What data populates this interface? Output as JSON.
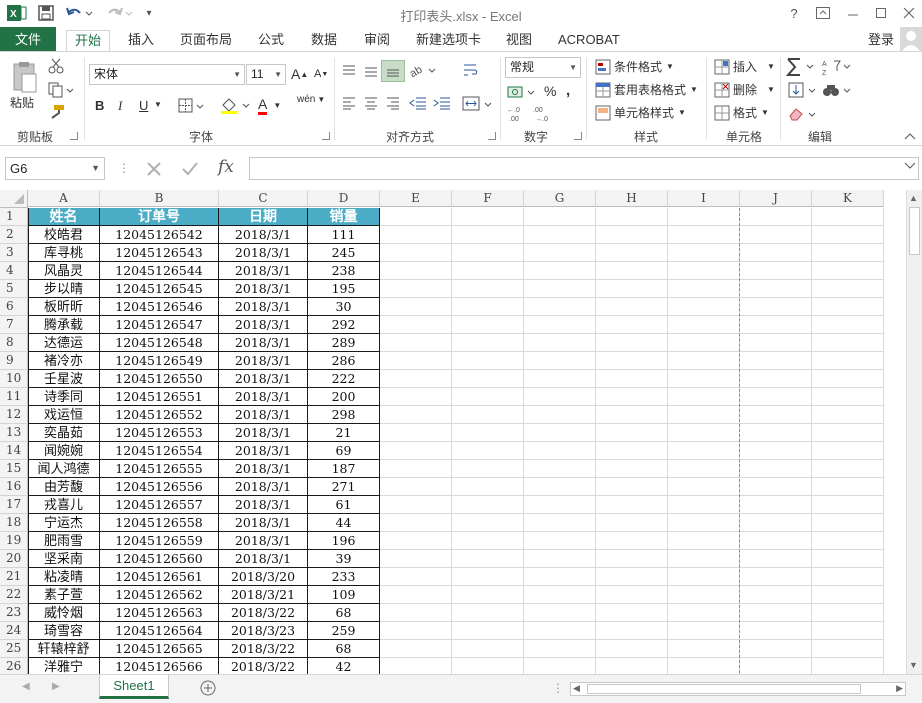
{
  "window": {
    "title": "打印表头.xlsx - Excel",
    "help": "?",
    "login": "登录"
  },
  "ribbon": {
    "file_tab": "文件",
    "tabs": [
      "开始",
      "插入",
      "页面布局",
      "公式",
      "数据",
      "审阅",
      "新建选项卡",
      "视图",
      "ACROBAT"
    ],
    "clipboard": {
      "paste": "粘贴",
      "label": "剪贴板"
    },
    "font": {
      "name": "宋体",
      "size": "11",
      "label": "字体",
      "bold": "B",
      "italic": "I",
      "underline": "U",
      "wen": "wén",
      "grow": "A",
      "shrink": "A",
      "color": "A"
    },
    "alignment": {
      "label": "对齐方式"
    },
    "number": {
      "format": "常规",
      "percent": "%",
      "comma": ",",
      "label": "数字"
    },
    "styles": {
      "conditional": "条件格式",
      "table": "套用表格格式",
      "cell": "单元格样式",
      "label": "样式"
    },
    "cells": {
      "insert": "插入",
      "delete": "删除",
      "format": "格式",
      "label": "单元格"
    },
    "editing": {
      "label": "编辑"
    }
  },
  "formula_bar": {
    "namebox": "G6",
    "fx": "fx",
    "value": ""
  },
  "columns": [
    "A",
    "B",
    "C",
    "D",
    "E",
    "F",
    "G",
    "H",
    "I",
    "J",
    "K"
  ],
  "table": {
    "headers": [
      "姓名",
      "订单号",
      "日期",
      "销量"
    ],
    "rows": [
      [
        "校皓君",
        "12045126542",
        "2018/3/1",
        "111"
      ],
      [
        "库寻桃",
        "12045126543",
        "2018/3/1",
        "245"
      ],
      [
        "风晶灵",
        "12045126544",
        "2018/3/1",
        "238"
      ],
      [
        "步以晴",
        "12045126545",
        "2018/3/1",
        "195"
      ],
      [
        "板昕昕",
        "12045126546",
        "2018/3/1",
        "30"
      ],
      [
        "腾承载",
        "12045126547",
        "2018/3/1",
        "292"
      ],
      [
        "达德运",
        "12045126548",
        "2018/3/1",
        "289"
      ],
      [
        "褚冷亦",
        "12045126549",
        "2018/3/1",
        "286"
      ],
      [
        "壬星波",
        "12045126550",
        "2018/3/1",
        "222"
      ],
      [
        "诗季同",
        "12045126551",
        "2018/3/1",
        "200"
      ],
      [
        "戏运恒",
        "12045126552",
        "2018/3/1",
        "298"
      ],
      [
        "奕晶茹",
        "12045126553",
        "2018/3/1",
        "21"
      ],
      [
        "闻婉婉",
        "12045126554",
        "2018/3/1",
        "69"
      ],
      [
        "闻人鸿德",
        "12045126555",
        "2018/3/1",
        "187"
      ],
      [
        "由芳馥",
        "12045126556",
        "2018/3/1",
        "271"
      ],
      [
        "戎喜儿",
        "12045126557",
        "2018/3/1",
        "61"
      ],
      [
        "宁运杰",
        "12045126558",
        "2018/3/1",
        "44"
      ],
      [
        "肥雨雪",
        "12045126559",
        "2018/3/1",
        "196"
      ],
      [
        "坚采南",
        "12045126560",
        "2018/3/1",
        "39"
      ],
      [
        "粘凌晴",
        "12045126561",
        "2018/3/20",
        "233"
      ],
      [
        "素子萱",
        "12045126562",
        "2018/3/21",
        "109"
      ],
      [
        "威怜烟",
        "12045126563",
        "2018/3/22",
        "68"
      ],
      [
        "琦雪容",
        "12045126564",
        "2018/3/23",
        "259"
      ],
      [
        "轩辕梓舒",
        "12045126565",
        "2018/3/22",
        "68"
      ],
      [
        "洋雅宁",
        "12045126566",
        "2018/3/22",
        "42"
      ]
    ]
  },
  "sheets": [
    "Sheet1"
  ],
  "colors": {
    "excel_green": "#217346",
    "header_fill": "#4bacc6"
  }
}
